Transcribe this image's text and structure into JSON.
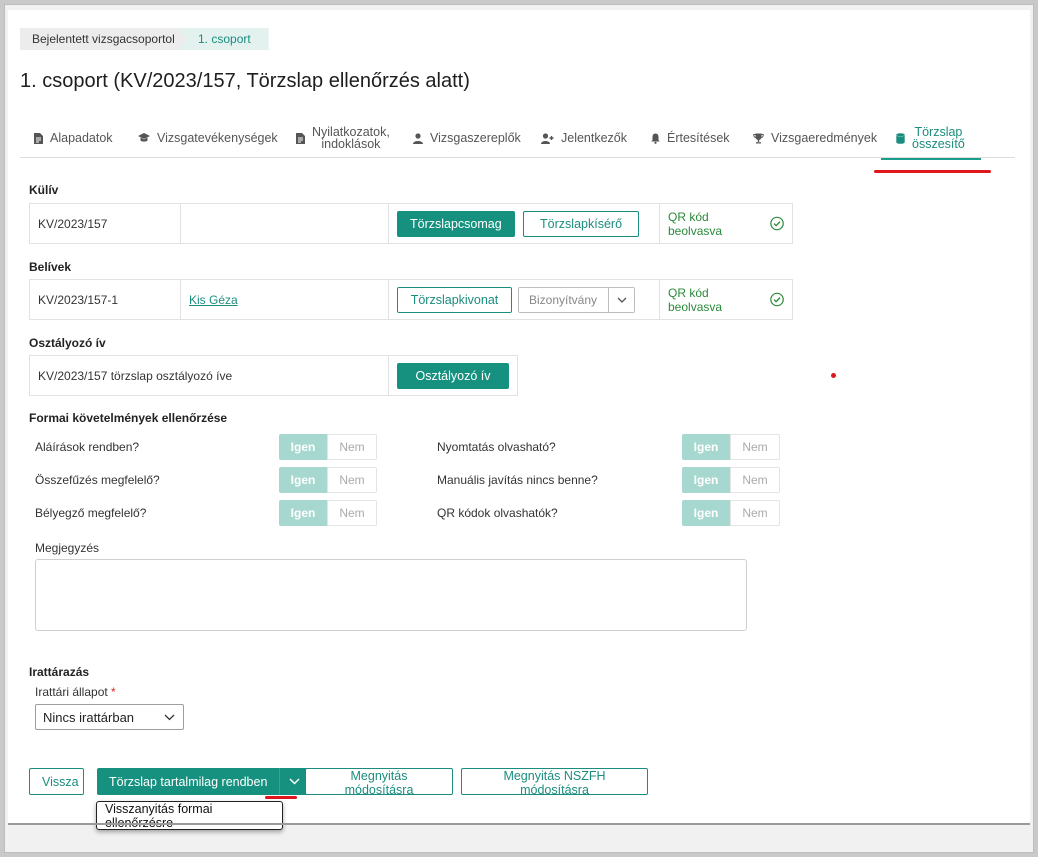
{
  "breadcrumb": [
    "Bejelentett vizsgacsoportok",
    "1. csoport"
  ],
  "page_title": "1. csoport (KV/2023/157, Törzslap ellenőrzés alatt)",
  "tabs": [
    {
      "label": "Alapadatok",
      "icon": "document-icon"
    },
    {
      "label": "Vizsgatevékenységek",
      "icon": "graduation-cap-icon"
    },
    {
      "label_line1": "Nyilatkozatok,",
      "label_line2": "indoklások",
      "icon": "document-icon"
    },
    {
      "label": "Vizsgaszereplők",
      "icon": "person-icon"
    },
    {
      "label": "Jelentkezők",
      "icon": "user-plus-icon"
    },
    {
      "label": "Értesítések",
      "icon": "bell-icon"
    },
    {
      "label": "Vizsgaeredmények",
      "icon": "trophy-icon"
    },
    {
      "label_line1": "Törzslap",
      "label_line2": "összesítő",
      "icon": "database-icon",
      "active": true
    }
  ],
  "kulív": {
    "heading": "Külív",
    "code": "KV/2023/157",
    "btn_package": "Törzslapcsomag",
    "btn_cover": "Törzslapkísérő",
    "qr_status": "QR kód beolvasva"
  },
  "belivek": {
    "heading": "Belívek",
    "code": "KV/2023/157-1",
    "person": "Kis Géza",
    "btn_extract": "Törzslapkivonat",
    "certificate_select": "Bizonyítvány",
    "qr_status": "QR kód beolvasva"
  },
  "osztalyozo": {
    "heading": "Osztályozó ív",
    "text": "KV/2023/157 törzslap osztályozó íve",
    "btn": "Osztályozó ív"
  },
  "formal": {
    "heading": "Formai követelmények ellenőrzése",
    "yes": "Igen",
    "no": "Nem",
    "left": [
      "Aláírások rendben?",
      "Összefűzés megfelelő?",
      "Bélyegző megfelelő?"
    ],
    "right": [
      "Nyomtatás olvasható?",
      "Manuális javítás nincs benne?",
      "QR kódok olvashatók?"
    ]
  },
  "note": {
    "label": "Megjegyzés",
    "value": ""
  },
  "archive": {
    "heading": "Irattárazás",
    "state_label": "Irattári állapot",
    "required_mark": "*",
    "state_value": "Nincs irattárban"
  },
  "actions": {
    "back": "Vissza",
    "content_ok": "Törzslap tartalmilag rendben",
    "open_modify": "Megnyitás módosításra",
    "open_nszfh": "Megnyitás NSZFH módosításra",
    "menu_item": "Visszanyitás formai ellenőrzésre"
  },
  "colors": {
    "accent": "#16917f",
    "toggle_yes": "#a6d8d0",
    "qr_green": "#2a8a3a",
    "annotation_red": "#e0161d"
  }
}
